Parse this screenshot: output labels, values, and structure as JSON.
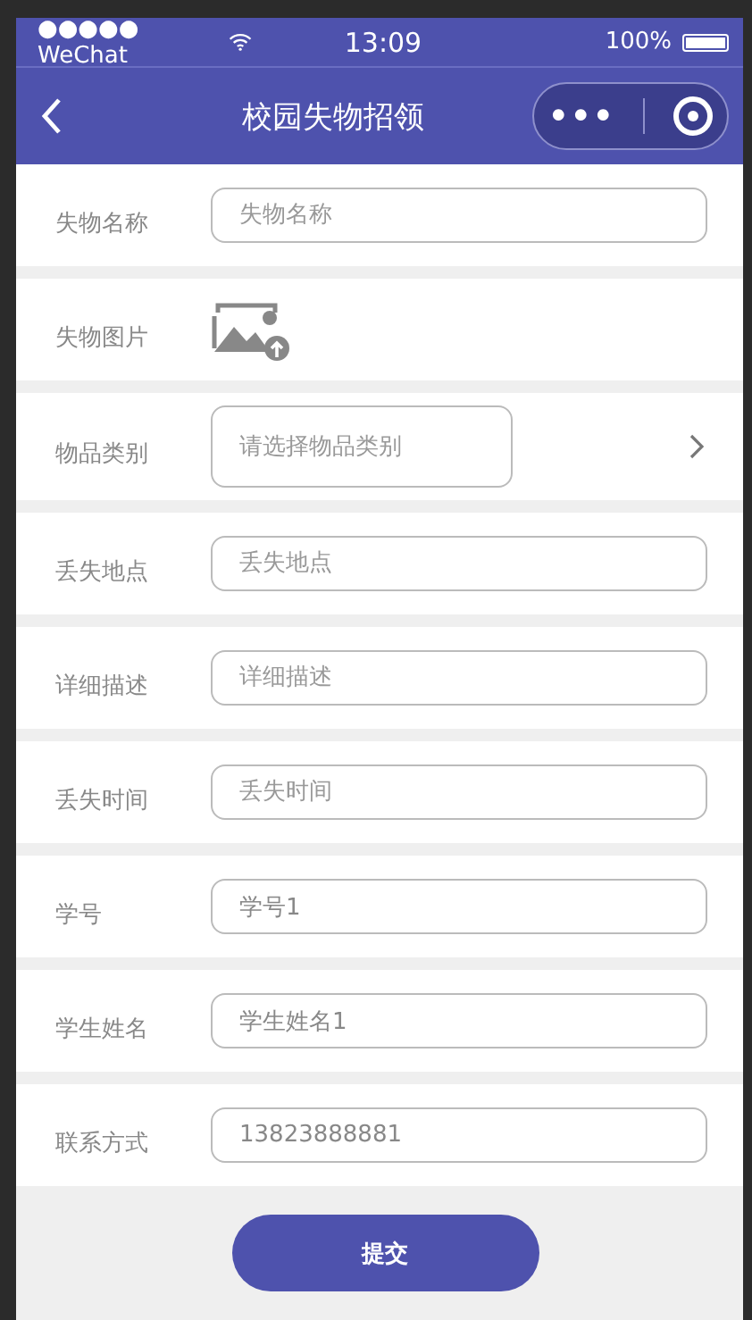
{
  "status_bar": {
    "carrier": "●●●●● WeChat",
    "time": "13:09",
    "battery": "100%"
  },
  "nav_bar": {
    "title": "校园失物招领",
    "menu": "•••"
  },
  "rows": [
    {
      "kind": "input",
      "label": "失物名称",
      "placeholder": "失物名称"
    },
    {
      "kind": "image",
      "label": "失物图片"
    },
    {
      "kind": "select",
      "label": "物品类别",
      "placeholder": "请选择物品类别"
    },
    {
      "kind": "input",
      "label": "丢失地点",
      "placeholder": "丢失地点"
    },
    {
      "kind": "input",
      "label": "详细描述",
      "placeholder": "详细描述"
    },
    {
      "kind": "input",
      "label": "丢失时间",
      "placeholder": "丢失时间"
    },
    {
      "kind": "input",
      "label": "学号",
      "value": "学号1"
    },
    {
      "kind": "input",
      "label": "学生姓名",
      "value": "学生姓名1"
    },
    {
      "kind": "input",
      "label": "联系方式",
      "value": "13823888881"
    }
  ],
  "submit_button": "提交"
}
